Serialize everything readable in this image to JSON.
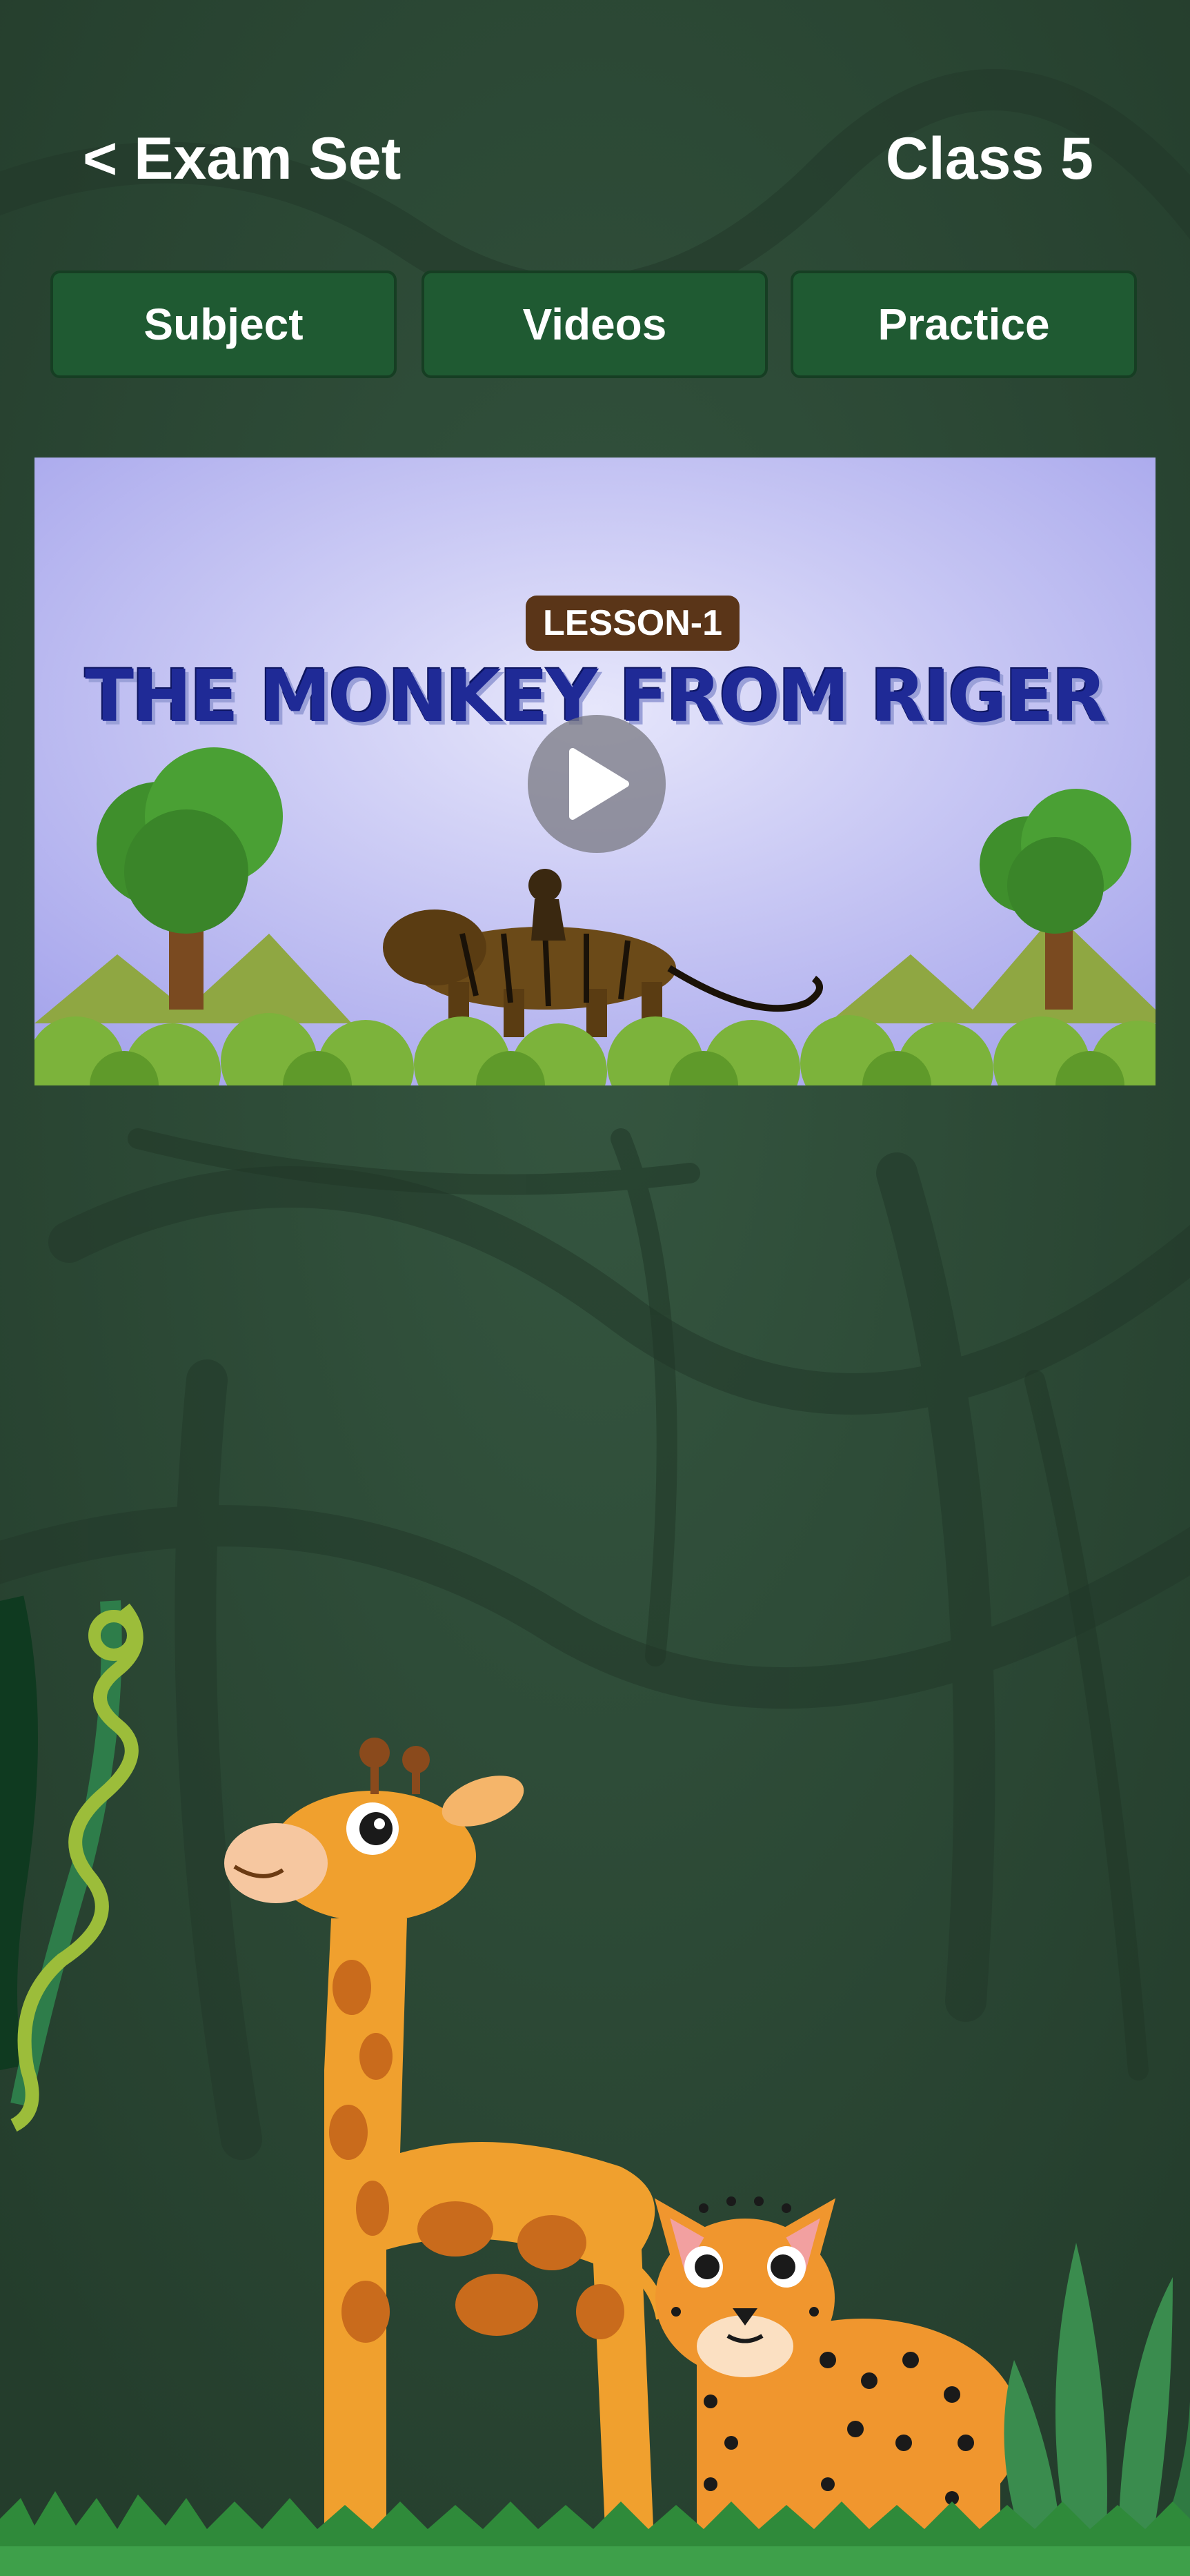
{
  "header": {
    "back_label": "< Exam Set",
    "class_label": "Class 5"
  },
  "tabs": [
    {
      "label": "Subject"
    },
    {
      "label": "Videos"
    },
    {
      "label": "Practice"
    }
  ],
  "video": {
    "badge": "LESSON-1",
    "title": "THE MONKEY FROM RIGER"
  },
  "colors": {
    "background": "#2d4a36",
    "tab_fill": "#1f5a32",
    "title_blue": "#1f2a96"
  }
}
